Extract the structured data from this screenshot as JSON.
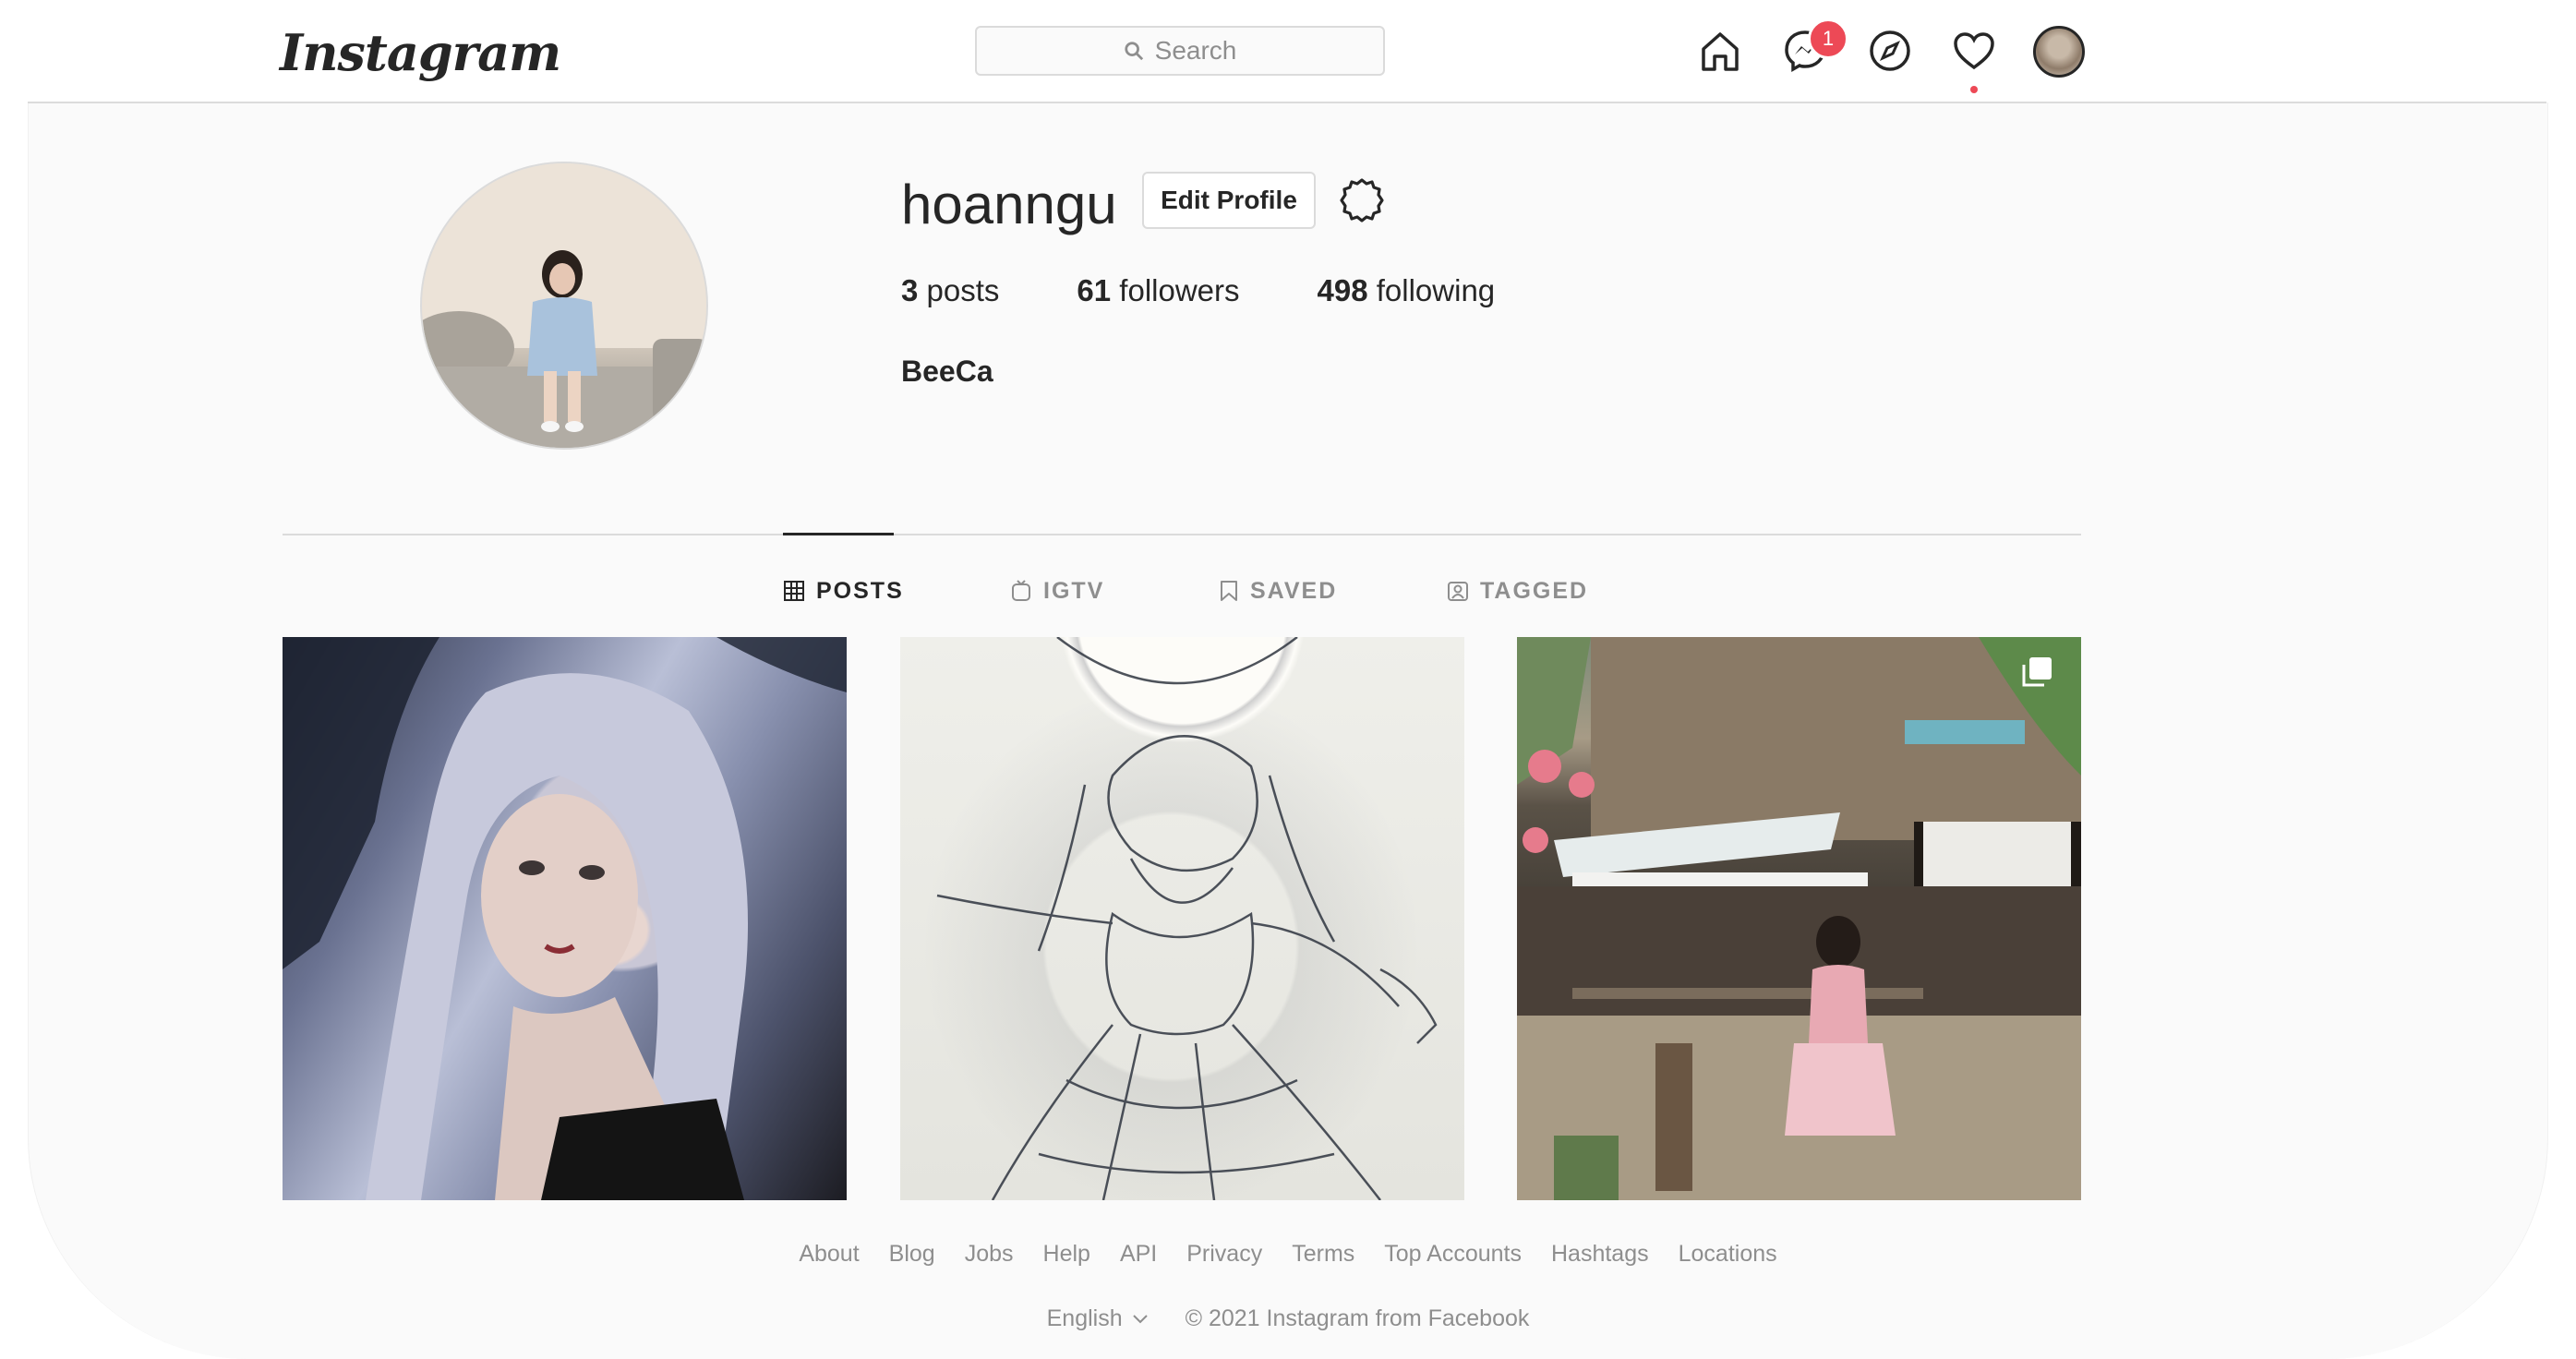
{
  "header": {
    "logo_text": "Instagram",
    "search_placeholder": "Search",
    "messages_badge": "1",
    "icons": [
      "home-icon",
      "messenger-icon",
      "explore-icon",
      "activity-heart-icon",
      "profile-avatar-icon"
    ]
  },
  "profile": {
    "username": "hoanngu",
    "edit_button": "Edit Profile",
    "posts_count": "3",
    "posts_label": "posts",
    "followers_count": "61",
    "followers_label": "followers",
    "following_count": "498",
    "following_label": "following",
    "full_name": "BeeCa"
  },
  "tabs": [
    {
      "label": "POSTS",
      "icon": "grid-icon",
      "active": true
    },
    {
      "label": "IGTV",
      "icon": "igtv-icon",
      "active": false
    },
    {
      "label": "SAVED",
      "icon": "bookmark-icon",
      "active": false
    },
    {
      "label": "TAGGED",
      "icon": "tag-icon",
      "active": false
    }
  ],
  "posts": [
    {
      "name": "post-painting"
    },
    {
      "name": "post-sketch"
    },
    {
      "name": "post-photo",
      "multiple": true
    }
  ],
  "footer": {
    "links": [
      "About",
      "Blog",
      "Jobs",
      "Help",
      "API",
      "Privacy",
      "Terms",
      "Top Accounts",
      "Hashtags",
      "Locations"
    ],
    "language": "English",
    "copyright": "© 2021 Instagram from Facebook"
  },
  "colors": {
    "badge": "#ed4956",
    "text_primary": "#262626",
    "text_secondary": "#8e8e8e",
    "border": "#dbdbdb"
  }
}
